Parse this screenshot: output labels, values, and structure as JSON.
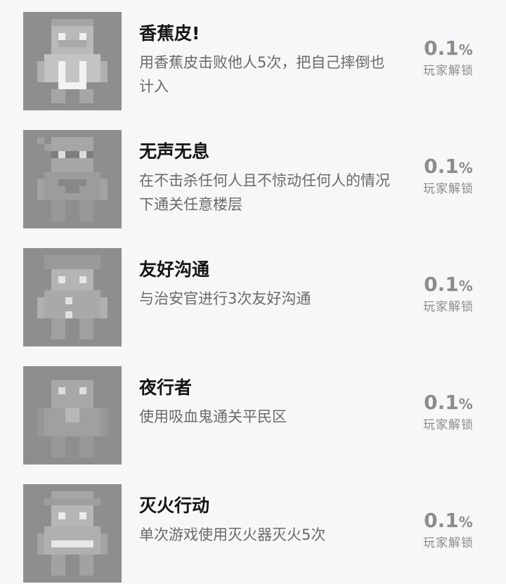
{
  "achievements": [
    {
      "icon": "banana-peel-character-icon",
      "title": "香蕉皮!",
      "description": "用香蕉皮击败他人5次，把自己摔倒也计入",
      "percent": "0.1",
      "percent_unit": "%",
      "unlock_label": "玩家解锁"
    },
    {
      "icon": "ninja-character-icon",
      "title": "无声无息",
      "description": "在不击杀任何人且不惊动任何人的情况下通关任意楼层",
      "percent": "0.1",
      "percent_unit": "%",
      "unlock_label": "玩家解锁"
    },
    {
      "icon": "police-officer-character-icon",
      "title": "友好沟通",
      "description": "与治安官进行3次友好沟通",
      "percent": "0.1",
      "percent_unit": "%",
      "unlock_label": "玩家解锁"
    },
    {
      "icon": "vampire-character-icon",
      "title": "夜行者",
      "description": "使用吸血鬼通关平民区",
      "percent": "0.1",
      "percent_unit": "%",
      "unlock_label": "玩家解锁"
    },
    {
      "icon": "firefighter-character-icon",
      "title": "灭火行动",
      "description": "单次游戏使用灭火器灭火5次",
      "percent": "0.1",
      "percent_unit": "%",
      "unlock_label": "玩家解锁"
    }
  ]
}
